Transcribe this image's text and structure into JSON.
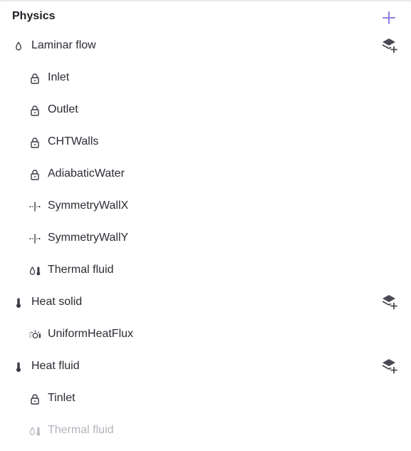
{
  "panel": {
    "title": "Physics",
    "add_icon": "plus-icon",
    "accent_color": "#8b7fe0"
  },
  "tree": {
    "laminar_flow": {
      "label": "Laminar flow",
      "icon": "droplet-icon",
      "action_icon": "add-layer-icon"
    },
    "inlet": {
      "label": "Inlet",
      "icon": "lock-icon"
    },
    "outlet": {
      "label": "Outlet",
      "icon": "lock-icon"
    },
    "cht_walls": {
      "label": "CHTWalls",
      "icon": "lock-icon"
    },
    "adiabatic_water": {
      "label": "AdiabaticWater",
      "icon": "lock-icon"
    },
    "symmetry_wall_x": {
      "label": "SymmetryWallX",
      "icon": "symmetry-icon"
    },
    "symmetry_wall_y": {
      "label": "SymmetryWallY",
      "icon": "symmetry-icon"
    },
    "thermal_fluid_1": {
      "label": "Thermal fluid",
      "icon": "droplet-thermometer-icon"
    },
    "heat_solid": {
      "label": "Heat solid",
      "icon": "thermometer-icon",
      "action_icon": "add-layer-icon"
    },
    "uniform_heat_flux": {
      "label": "UniformHeatFlux",
      "icon": "heat-flux-icon"
    },
    "heat_fluid": {
      "label": "Heat fluid",
      "icon": "thermometer-icon",
      "action_icon": "add-layer-icon"
    },
    "tinlet": {
      "label": "Tinlet",
      "icon": "lock-icon"
    },
    "thermal_fluid_2": {
      "label": "Thermal fluid",
      "icon": "droplet-thermometer-icon",
      "state": "disabled"
    }
  }
}
